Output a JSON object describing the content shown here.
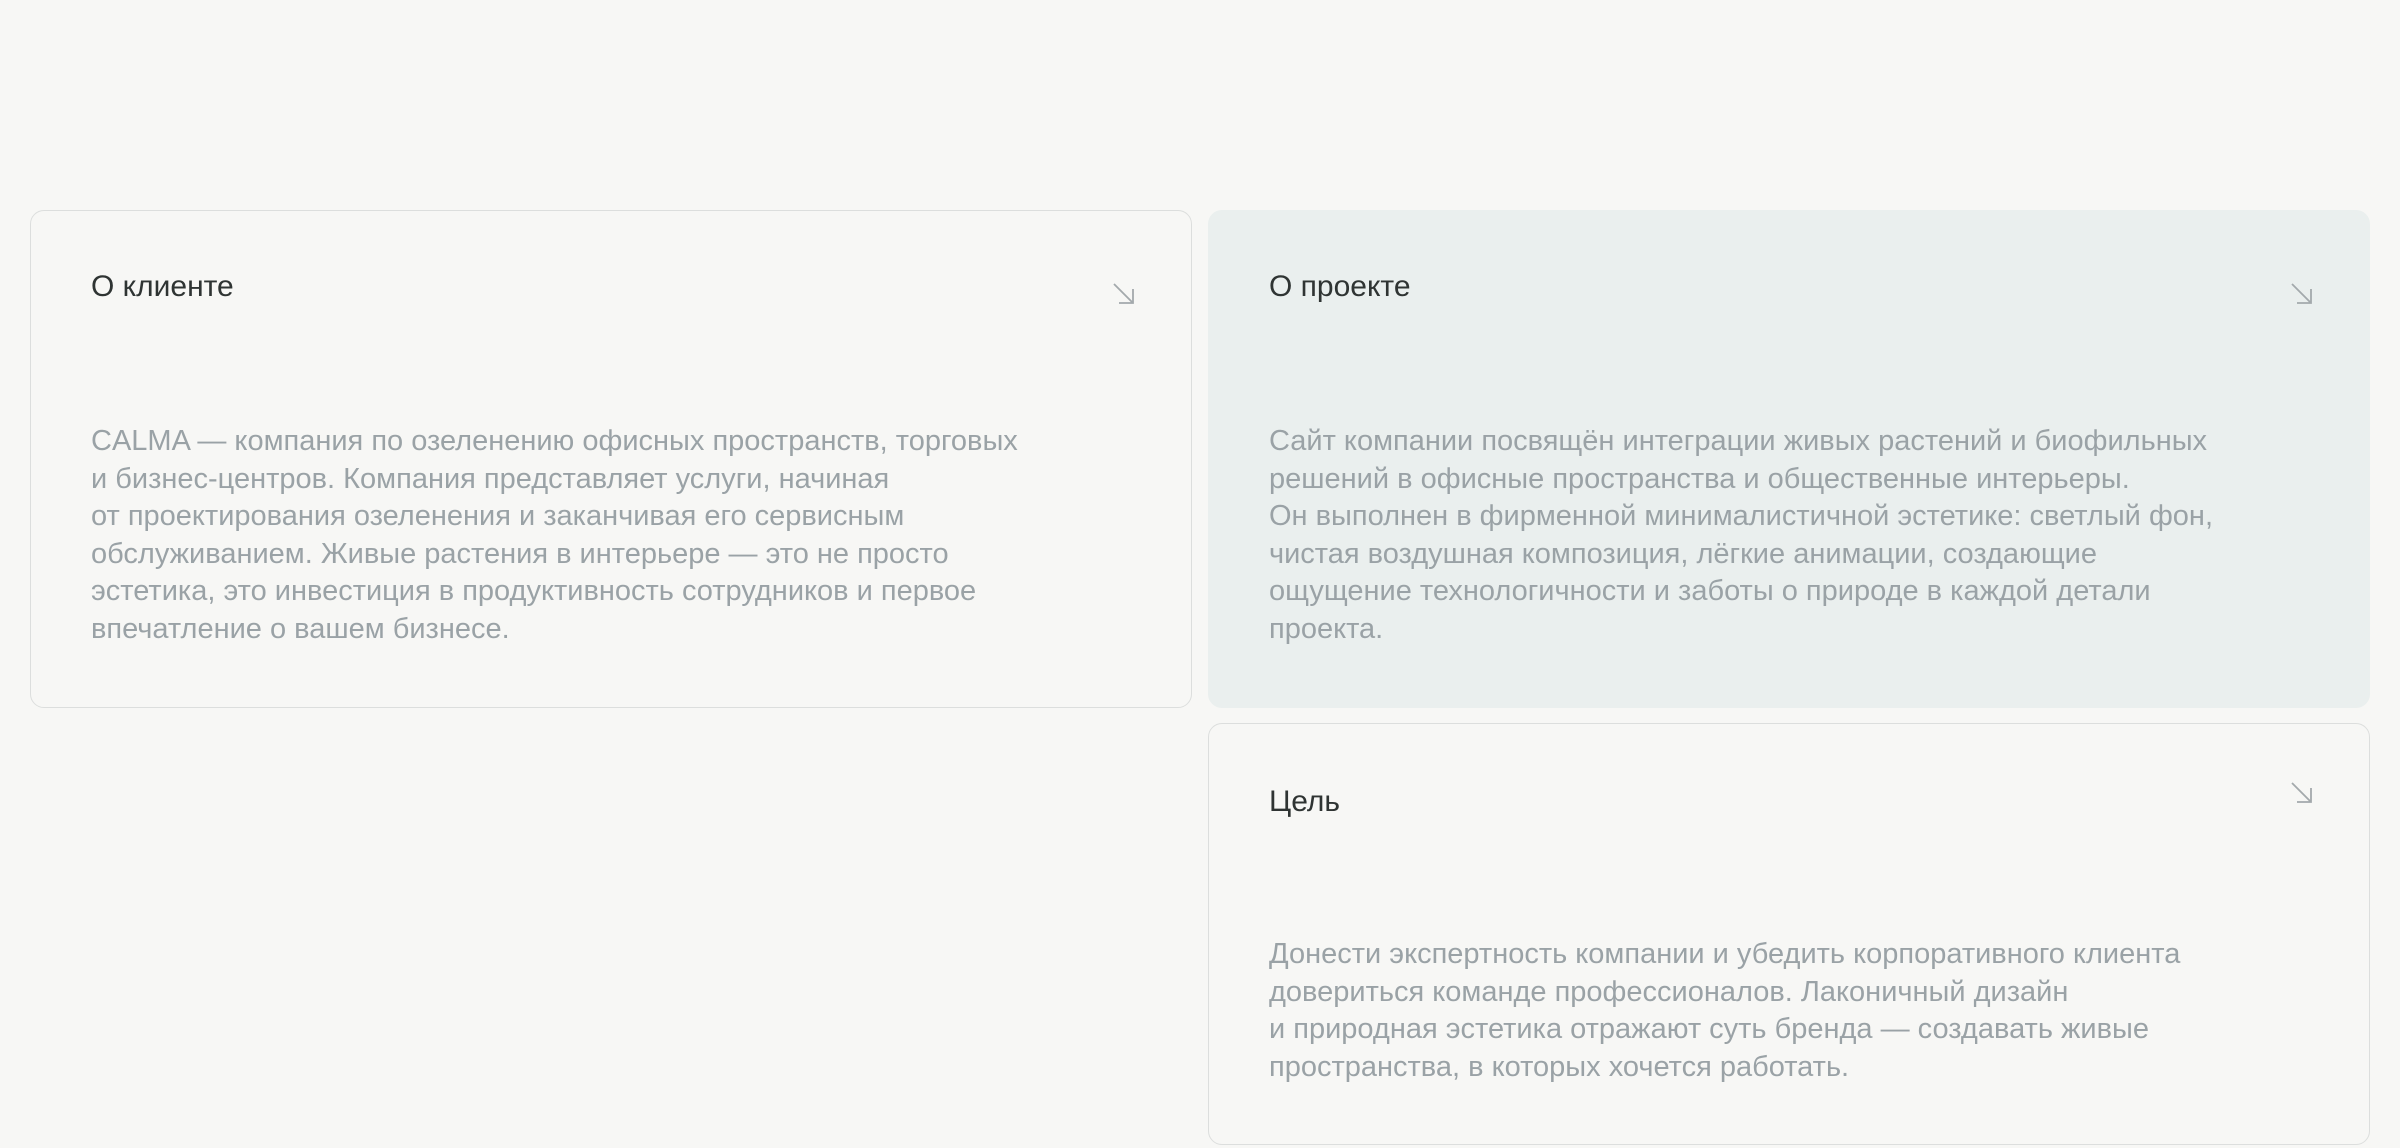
{
  "cards": [
    {
      "title": "О клиенте",
      "icon": "arrow-down-right-icon",
      "body": "CALMA — компания по озеленению офисных пространств, торговых\nи бизнес-центров. Компания представляет услуги, начиная\nот проектирования озеленения и заканчивая его сервисным\nобслуживанием. Живые растения в интерьере — это не просто\nэстетика, это инвестиция в продуктивность сотрудников и первое\nвпечатление о вашем бизнесе."
    },
    {
      "title": "О проекте",
      "icon": "arrow-down-right-icon",
      "body": "Сайт компании посвящён интеграции живых растений и биофильных\nрешений в офисные пространства и общественные интерьеры.\nОн выполнен в фирменной минималистичной эстетике: светлый фон,\nчистая воздушная композиция, лёгкие анимации, создающие\nощущение технологичности и заботы о природе в каждой детали\nпроекта."
    },
    {
      "title": "Цель",
      "icon": "arrow-down-right-icon",
      "body": "Донести экспертность компании и убедить корпоративного клиента\nдовериться команде профессионалов. Лаконичный дизайн\nи природная эстетика отражают суть бренда — создавать живые\nпространства, в которых хочется работать."
    }
  ],
  "colors": {
    "background": "#f7f7f5",
    "card_filled": "#eaefee",
    "border": "#dcdedd",
    "title": "#2f3433",
    "body": "#9aa2a6",
    "icon": "#a3a9ac"
  }
}
